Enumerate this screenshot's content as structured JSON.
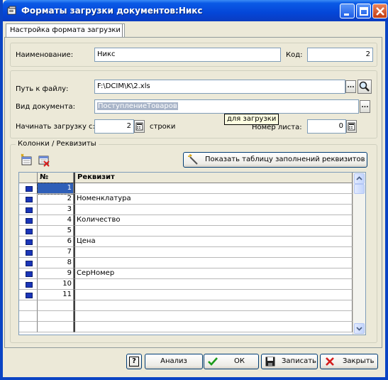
{
  "window": {
    "title": "Форматы загрузки документов:Никс",
    "colors": {
      "titlebar": "#0446d8",
      "close": "#c53c11",
      "face": "#ece9d8"
    }
  },
  "tabs": [
    {
      "label": "Настройка формата загрузки",
      "active": true
    }
  ],
  "form": {
    "name_label": "Наименование:",
    "name_value": "Никс",
    "code_label": "Код:",
    "code_value": "2",
    "path_label": "Путь к файлу:",
    "path_value": "F:\\DCIM\\K\\2.xls",
    "path_browse": "...",
    "doctype_label": "Вид документа:",
    "doctype_value": "ПоступлениеТоваров",
    "doctype_browse": "...",
    "start_label": "Начинать загрузку с:",
    "start_value": "2",
    "start_suffix": "строки",
    "sheet_label": "Номер листа:",
    "sheet_value": "0",
    "tooltip": "для загрузки"
  },
  "columns_group": {
    "label": "Колонки / Реквизиты",
    "show_table_button": "Показать таблицу заполнений реквизитов"
  },
  "grid": {
    "headers": [
      "№",
      "Реквизит"
    ],
    "rows": [
      {
        "num": "1",
        "req": ""
      },
      {
        "num": "2",
        "req": "Номенклатура"
      },
      {
        "num": "3",
        "req": ""
      },
      {
        "num": "4",
        "req": "Количество"
      },
      {
        "num": "5",
        "req": ""
      },
      {
        "num": "6",
        "req": "Цена"
      },
      {
        "num": "7",
        "req": ""
      },
      {
        "num": "8",
        "req": ""
      },
      {
        "num": "9",
        "req": "СерНомер"
      },
      {
        "num": "10",
        "req": ""
      },
      {
        "num": "11",
        "req": ""
      }
    ],
    "empty_rows": 3
  },
  "footer": {
    "help": "?",
    "analyze": "Анализ",
    "ok": "ОК",
    "save": "Записать",
    "close": "Закрыть"
  }
}
